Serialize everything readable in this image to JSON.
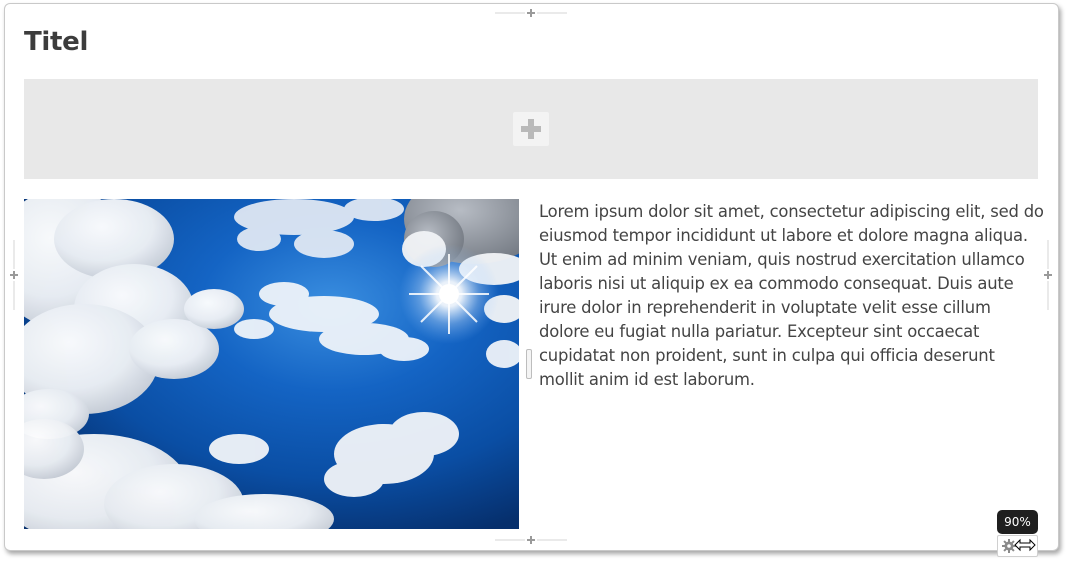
{
  "block": {
    "title": "Titel"
  },
  "dropzone": {
    "add_icon": "plus-icon"
  },
  "image": {
    "subject": "blue sky with white clouds and sun",
    "sky_color": "#0a52a8"
  },
  "text": {
    "body": "Lorem ipsum dolor sit amet, consectetur adipiscing elit, sed do eiusmod tempor incididunt ut labore et dolore magna aliqua. Ut enim ad minim veniam, quis nostrud exercitation ullamco laboris nisi ut aliquip ex ea commodo consequat. Duis aute irure dolor in reprehenderit in voluptate velit esse cillum dolore eu fugiat nulla pariatur. Excepteur sint occaecat cupidatat non proident, sunt in culpa qui officia deserunt mollit anim id est laborum."
  },
  "controls": {
    "zoom_label": "90%",
    "settings_icon": "gear-icon",
    "cursor_icon": "resize-horizontal-cursor-icon"
  },
  "colors": {
    "dropzone_bg": "#e8e8e8",
    "text": "#444444",
    "badge_bg": "#1f1f1f"
  }
}
